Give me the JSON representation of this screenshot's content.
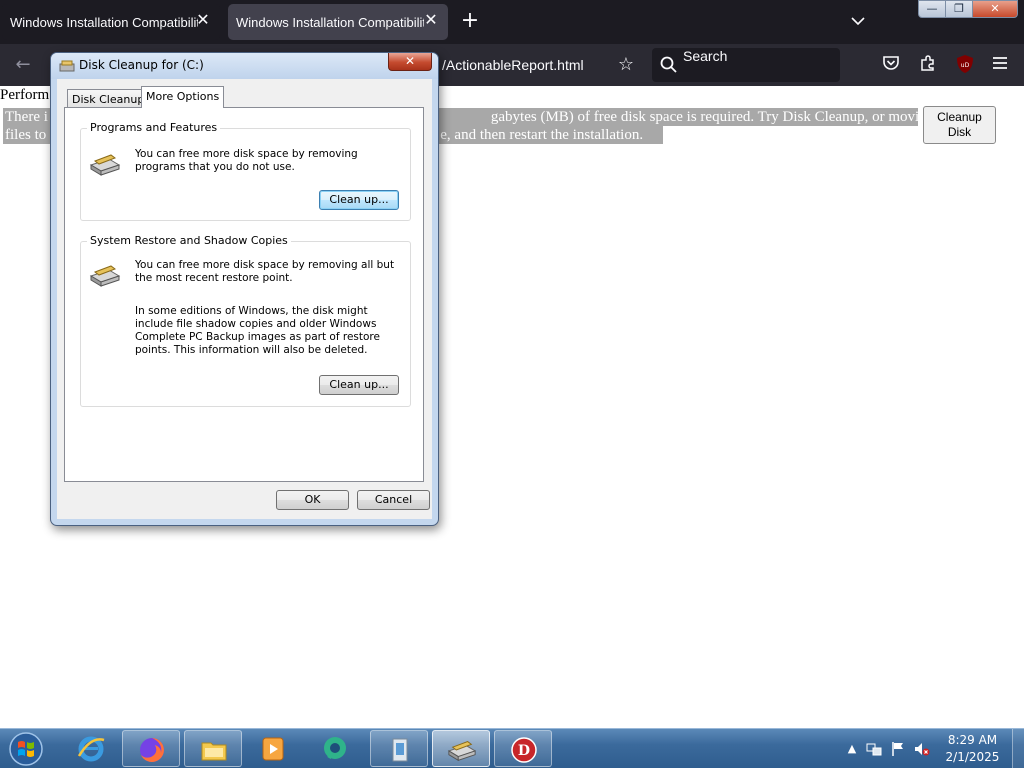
{
  "browser": {
    "tabs": [
      {
        "title": "Windows Installation Compatibility",
        "close": "✕"
      },
      {
        "title": "Windows Installation Compatibility",
        "close": "✕"
      }
    ],
    "new_tab": "+",
    "tab_list": "⌄",
    "window_controls": {
      "minimize": "—",
      "maximize": "❐",
      "close": "✕"
    },
    "back": "←",
    "url_text": "/ActionableReport.html",
    "bookmark_icon": "☆",
    "search_placeholder": "Search",
    "toolbar_icons": {
      "pocket": "pocket-icon",
      "extensions": "puzzle-icon",
      "ublock": "ublock-icon",
      "menu": "hamburger-icon"
    },
    "ublock_label": "uD"
  },
  "page": {
    "heading": "Perform",
    "line1_left": "There i",
    "line1_right": "gabytes (MB) of free disk space is required. Try Disk Cleanup, or moving",
    "line2_left": "files to",
    "line2_right": "e, and then restart the installation.",
    "cleanup_button": "Cleanup Disk"
  },
  "dialog": {
    "title": "Disk Cleanup for  (C:)",
    "close": "✕",
    "tabs": [
      "Disk Cleanup",
      "More Options"
    ],
    "active_tab": "More Options",
    "programs_group": {
      "title": "Programs and Features",
      "description": "You can free more disk space by removing programs that you do not use.",
      "button": "Clean up..."
    },
    "restore_group": {
      "title": "System Restore and Shadow Copies",
      "description1": "You can free more disk space by removing all but the most recent restore point.",
      "description2": "In some editions of Windows, the disk might include file shadow copies and older Windows Complete PC Backup images as part of restore points. This information will also be deleted.",
      "button": "Clean up..."
    },
    "ok": "OK",
    "cancel": "Cancel"
  },
  "taskbar": {
    "items": [
      "internet-explorer",
      "firefox",
      "windows-explorer",
      "media-player",
      "messenger",
      "installer",
      "disk-cleanup",
      "app"
    ],
    "active_item": "disk-cleanup",
    "clock_time": "8:29 AM",
    "clock_date": "2/1/2025",
    "tray_arrow": "▲"
  },
  "colors": {
    "browser_bg": "#1c1b22",
    "active_tab": "#42414d",
    "selection": "#a8a8a8",
    "dialog_frame": "#c4d7ee",
    "taskbar": "#3b6a9c"
  }
}
